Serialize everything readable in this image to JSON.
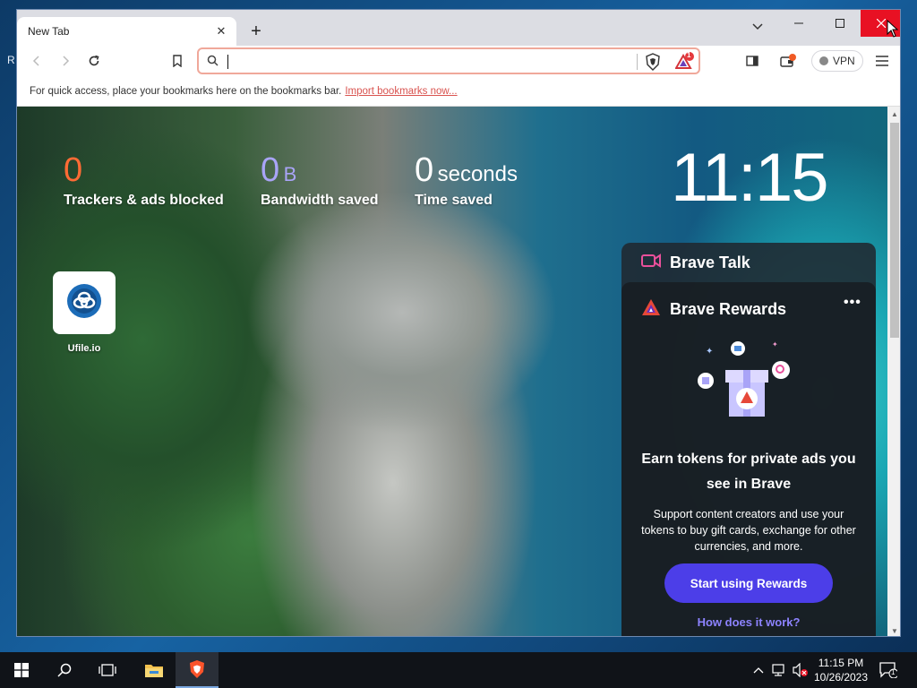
{
  "desktop": {
    "fragment_text": "R"
  },
  "browser": {
    "tab": {
      "title": "New Tab"
    },
    "omnibox": {
      "value": "",
      "placeholder": ""
    },
    "rewards_badge": "1",
    "vpn_label": "VPN",
    "bookmarks_bar": {
      "message": "For quick access, place your bookmarks here on the bookmarks bar.",
      "link": "Import bookmarks now..."
    }
  },
  "newtab": {
    "stats": {
      "trackers": {
        "value": "0",
        "label": "Trackers & ads blocked"
      },
      "bandwidth": {
        "value": "0",
        "unit": "B",
        "label": "Bandwidth saved"
      },
      "time": {
        "value": "0",
        "unit": "seconds",
        "label": "Time saved"
      }
    },
    "clock": "11:15",
    "top_sites": [
      {
        "name": "Ufile.io"
      }
    ],
    "brave_talk": {
      "title": "Brave Talk"
    },
    "brave_rewards": {
      "title": "Brave Rewards",
      "headline": "Earn tokens for private ads you see in Brave",
      "description": "Support content creators and use your tokens to buy gift cards, exchange for other currencies, and more.",
      "button": "Start using Rewards",
      "link": "How does it work?"
    }
  },
  "taskbar": {
    "time": "11:15 PM",
    "date": "10/26/2023",
    "notification_count": "1"
  },
  "colors": {
    "trackers": "#ff6b35",
    "bandwidth": "#a9a4f7",
    "rewards_button": "#4c3ee8",
    "close_button": "#e81123"
  }
}
